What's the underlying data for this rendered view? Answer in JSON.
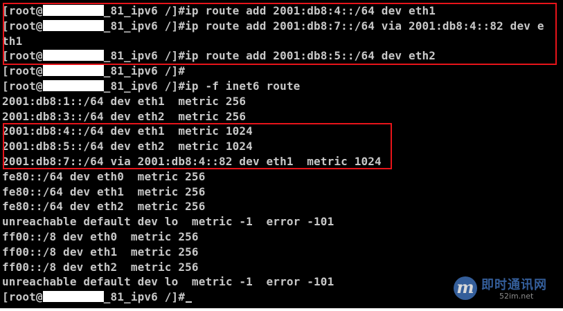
{
  "prompt": {
    "user_prefix": "[root@",
    "host_suffix": "_81_ipv6 /]#",
    "redaction_color": "#ffffff"
  },
  "commands": [
    "ip route add 2001:db8:4::/64 dev eth1",
    "ip route add 2001:db8:7::/64 via 2001:db8:4::82 dev e",
    "ip route add 2001:db8:5::/64 dev eth2",
    "",
    "ip -f inet6 route",
    ""
  ],
  "wrapped_continuation": "th1",
  "output_lines": [
    "2001:db8:1::/64 dev eth1  metric 256",
    "2001:db8:3::/64 dev eth2  metric 256",
    "2001:db8:4::/64 dev eth1  metric 1024",
    "2001:db8:5::/64 dev eth2  metric 1024",
    "2001:db8:7::/64 via 2001:db8:4::82 dev eth1  metric 1024",
    "fe80::/64 dev eth0  metric 256",
    "fe80::/64 dev eth1  metric 256",
    "fe80::/64 dev eth2  metric 256",
    "unreachable default dev lo  metric -1  error -101",
    "ff00::/8 dev eth0  metric 256",
    "ff00::/8 dev eth1  metric 256",
    "ff00::/8 dev eth2  metric 256",
    "unreachable default dev lo  metric -1  error -101"
  ],
  "colors": {
    "background": "#000000",
    "text": "#c8c8c8",
    "highlight_border": "#e8141a"
  },
  "watermark": {
    "logo_letter": "m",
    "name": "即时通讯网",
    "url": "52im.net"
  }
}
